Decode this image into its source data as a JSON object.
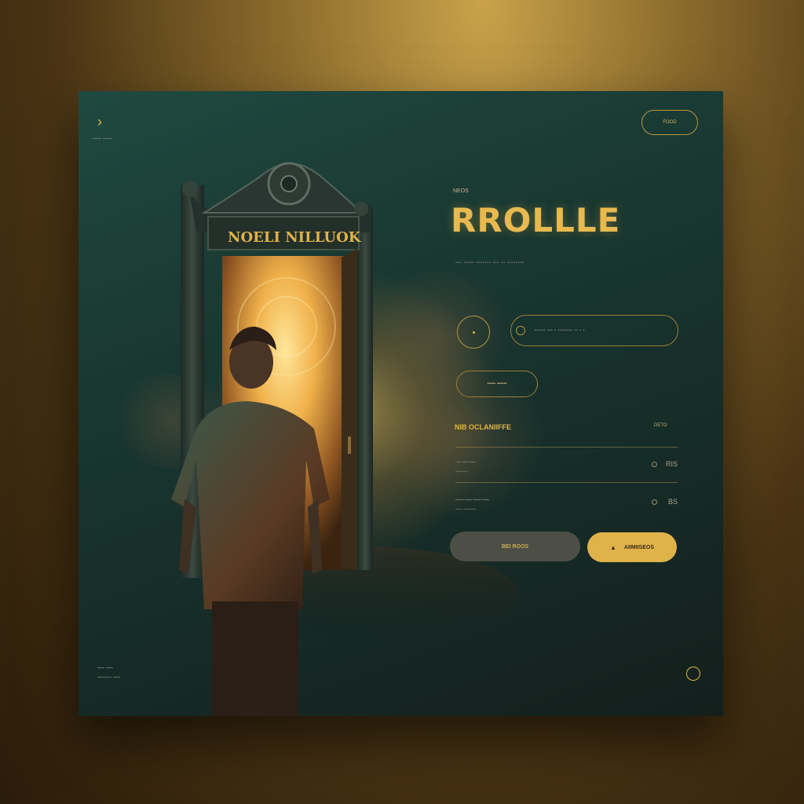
{
  "header": {
    "caption": "▪▪▪▪▪ ▪▪▪▪▪",
    "top_button": "FOOD"
  },
  "hero": {
    "door_sign": "NOELI NILLUOK",
    "eyebrow": "NEOS",
    "title": "RROLLLE",
    "subtitle": "▪▪▪ ▪▪▪▪▪ ▪▪▪▪▪▪▪ ▪▪▪ ▪▪ ▪▪▪▪▪▪▪▪"
  },
  "controls": {
    "search_placeholder": "▪▪▪▪▪▪ ▪▪▪ ▪ ▪▪▪▪▪▪▪▪ ▪▪ ▪ ▪",
    "pill_label": "▪▪▪▪▪ ▪▪▪▪▪▪"
  },
  "section": {
    "title": "NIB OCLANIIFFE",
    "tag": "DETO",
    "rows": [
      {
        "line1": "▪▪▪▪ ▪▪▪▪ ▪▪▪▪▪",
        "line2": "▪▪▪▪▪▪▪▪▪",
        "value": "RIS"
      },
      {
        "line1": "▪▪▪▪▪▪ ▪▪▪▪▪ ▪▪▪▪▪▪ ▪▪▪▪▪",
        "line2": "▪▪▪▪▪ ▪▪▪▪▪▪▪▪▪",
        "value": "BS"
      }
    ]
  },
  "actions": {
    "secondary_label": "BEI ROOS",
    "primary_label": "AIIMIISEOS"
  },
  "footer": {
    "line1": "▪▪▪▪ ▪▪▪▪",
    "line2": "▪▪▪▪▪▪▪▪ ▪▪▪▪"
  },
  "colors": {
    "accent": "#e0b545",
    "card_bg": "#17302b",
    "glow": "#ffc45a"
  }
}
